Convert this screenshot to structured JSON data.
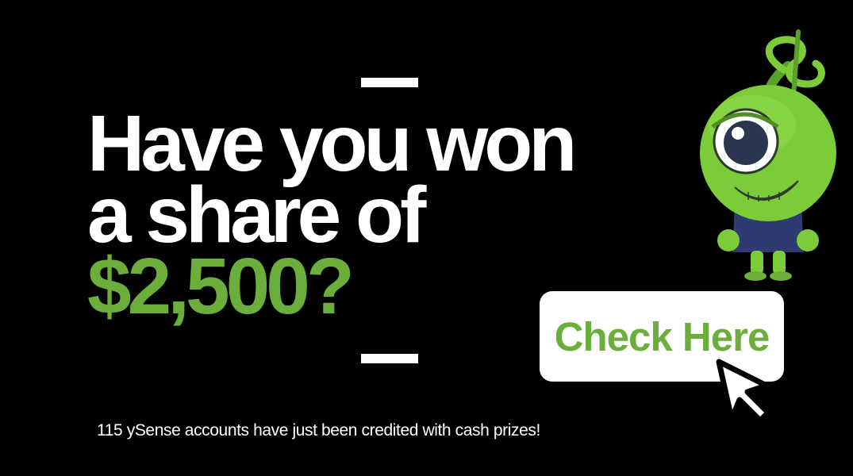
{
  "headline": {
    "line1": "Have you won",
    "line2": "a share of",
    "amount": "$2,500?"
  },
  "cta": {
    "label": "Check Here"
  },
  "caption": "115 ySense accounts have just been credited with cash prizes!",
  "icons": {
    "mascot": "ysense-alien-mascot-icon",
    "cursor": "mouse-pointer-icon"
  },
  "colors": {
    "background": "#000000",
    "accent_green": "#6cae3c",
    "text": "#ffffff"
  }
}
